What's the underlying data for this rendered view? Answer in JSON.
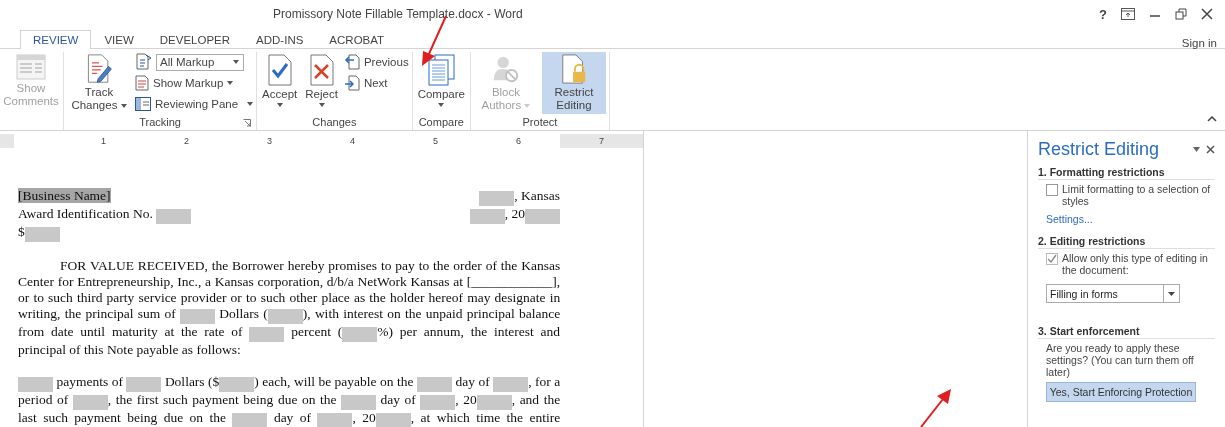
{
  "window": {
    "title": "Promissory Note Fillable Template.docx - Word",
    "help": "?",
    "account": "Sign in"
  },
  "tabs": [
    {
      "label": "REVIEW",
      "selected": true
    },
    {
      "label": "VIEW",
      "selected": false
    },
    {
      "label": "DEVELOPER",
      "selected": false
    },
    {
      "label": "ADD-INS",
      "selected": false
    },
    {
      "label": "ACROBAT",
      "selected": false
    }
  ],
  "ribbon": {
    "show_comments": {
      "label": "Show Comments",
      "disabled": true
    },
    "tracking": {
      "label": "Tracking",
      "track_changes": "Track Changes",
      "markup_select": "All Markup",
      "show_markup": "Show Markup",
      "reviewing_pane": "Reviewing Pane"
    },
    "changes": {
      "label": "Changes",
      "accept": "Accept",
      "reject": "Reject",
      "previous": "Previous",
      "next": "Next"
    },
    "compare": {
      "label": "Compare",
      "compare": "Compare"
    },
    "protect": {
      "label": "Protect",
      "block_authors": {
        "label": "Block Authors",
        "disabled": true
      },
      "restrict_editing": {
        "label": "Restrict Editing",
        "selected": true
      }
    }
  },
  "ruler": [
    "1",
    "2",
    "3",
    "4",
    "5",
    "6",
    "7"
  ],
  "document": {
    "header_lines": [
      {
        "left": [
          {
            "kind": "highlight",
            "text": "[Business Name]"
          }
        ],
        "right": [
          {
            "kind": "field"
          },
          {
            "kind": "text",
            "text": ", Kansas"
          }
        ]
      },
      {
        "left": [
          {
            "kind": "text",
            "text": "Award Identification No. "
          },
          {
            "kind": "field"
          }
        ],
        "right": [
          {
            "kind": "field"
          },
          {
            "kind": "text",
            "text": ", 20"
          },
          {
            "kind": "field"
          }
        ]
      },
      {
        "left": [
          {
            "kind": "text",
            "text": "$"
          },
          {
            "kind": "field"
          }
        ]
      }
    ],
    "paragraphs": [
      {
        "indent": true,
        "continues": false,
        "segments": [
          {
            "kind": "text",
            "text": "FOR VALUE RECEIVED, the Borrower hereby promises to pay to the order of the Kansas Center for Entrepreneurship, Inc., a Kansas corporation, d/b/a NetWork Kansas at [____________], or to such third party service provider or to such other place as the holder hereof may designate in writing, the principal sum of "
          },
          {
            "kind": "field"
          },
          {
            "kind": "text",
            "text": " Dollars ("
          },
          {
            "kind": "field"
          },
          {
            "kind": "text",
            "text": "), with interest on the unpaid principal balance from date until maturity at the rate of "
          },
          {
            "kind": "field"
          },
          {
            "kind": "text",
            "text": " percent ("
          },
          {
            "kind": "field"
          },
          {
            "kind": "text",
            "text": "%) per annum, the interest and principal of this Note payable as follows:"
          }
        ]
      },
      {
        "indent": false,
        "continues": true,
        "segments": [
          {
            "kind": "field"
          },
          {
            "kind": "text",
            "text": " payments of "
          },
          {
            "kind": "field"
          },
          {
            "kind": "text",
            "text": " Dollars ($"
          },
          {
            "kind": "field"
          },
          {
            "kind": "text",
            "text": ") each, will be payable on the "
          },
          {
            "kind": "field"
          },
          {
            "kind": "text",
            "text": " day of "
          },
          {
            "kind": "field"
          },
          {
            "kind": "text",
            "text": ", for a period of "
          },
          {
            "kind": "field"
          },
          {
            "kind": "text",
            "text": ", the first such payment being due on the "
          },
          {
            "kind": "field"
          },
          {
            "kind": "text",
            "text": " day of "
          },
          {
            "kind": "field"
          },
          {
            "kind": "text",
            "text": ", 20"
          },
          {
            "kind": "field"
          },
          {
            "kind": "text",
            "text": ", and the last such payment being due on the "
          },
          {
            "kind": "field"
          },
          {
            "kind": "text",
            "text": " day of "
          },
          {
            "kind": "field"
          },
          {
            "kind": "text",
            "text": ", 20"
          },
          {
            "kind": "field"
          },
          {
            "kind": "text",
            "text": ", at which time the entire"
          }
        ]
      }
    ]
  },
  "task_pane": {
    "title": "Restrict Editing",
    "sections": [
      {
        "heading": "1. Formatting restrictions",
        "option": {
          "label": "Limit formatting to a selection of styles",
          "checked": false
        },
        "link": "Settings..."
      },
      {
        "heading": "2. Editing restrictions",
        "option": {
          "label": "Allow only this type of editing in the document:",
          "checked": true
        },
        "select": "Filling in forms"
      },
      {
        "heading": "3. Start enforcement",
        "text": "Are you ready to apply these settings? (You can turn them off later)",
        "button": "Yes, Start Enforcing Protection"
      }
    ]
  }
}
